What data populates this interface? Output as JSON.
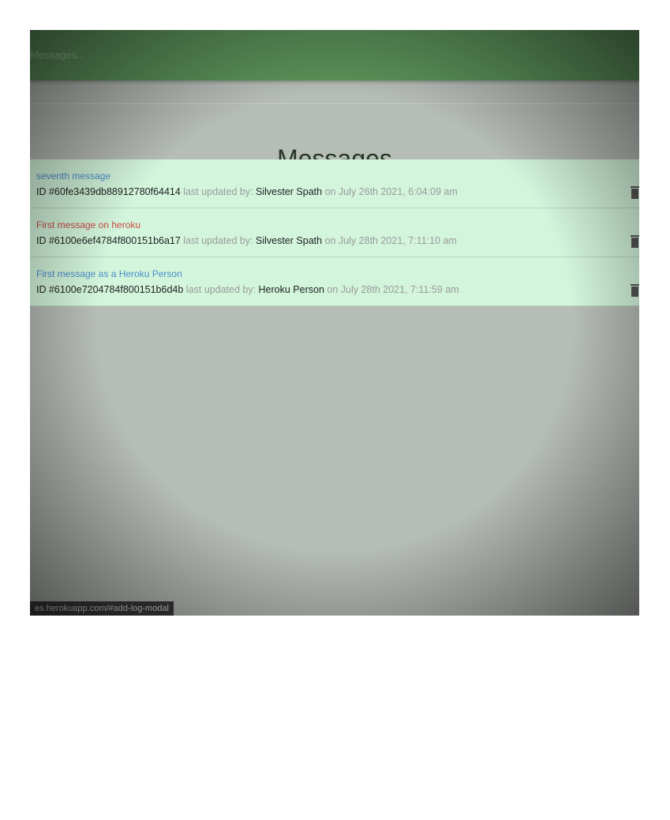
{
  "navbar": {
    "search_placeholder": "Messages..."
  },
  "page": {
    "title": "Messages"
  },
  "messages": [
    {
      "text": "seventh message",
      "id_prefix": "ID ",
      "id": "#60fe3439db88912780f64414",
      "updated_by_label": " last updated by: ",
      "user": "Silvester Spath",
      "date": " on July 26th 2021, 6:04:09 am"
    },
    {
      "text": "First message on heroku",
      "id_prefix": "ID ",
      "id": "#6100e6ef4784f800151b6a17",
      "updated_by_label": " last updated by: ",
      "user": "Silvester Spath",
      "date": " on July 28th 2021, 7:11:10 am"
    },
    {
      "text": "First message as a Heroku Person",
      "id_prefix": "ID ",
      "id": "#6100e7204784f800151b6d4b",
      "updated_by_label": " last updated by: ",
      "user": "Heroku Person",
      "date": " on July 28th 2021, 7:11:59 am"
    }
  ],
  "status_bar": {
    "url": "es.herokuapp.com/#add-log-modal"
  },
  "colors": {
    "navbar": "#5c925a",
    "list_item_bg": "#d3f5dc",
    "message_blue": "#4a8bc9",
    "message_red": "#c94a42"
  },
  "icons": [
    "trash-icon"
  ]
}
